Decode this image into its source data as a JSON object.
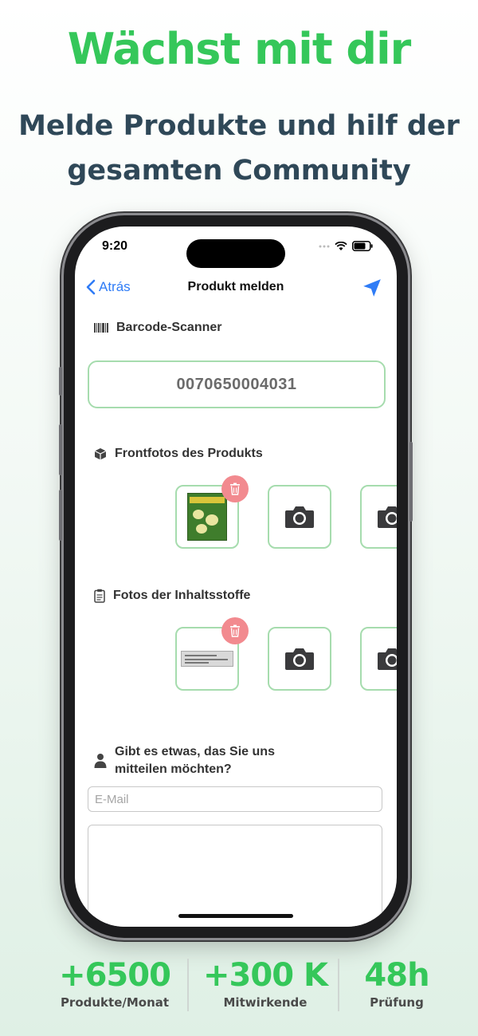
{
  "promo": {
    "headline": "Wächst mit dir",
    "subline_1": "Melde Produkte und hilf der",
    "subline_2": "gesamten Community"
  },
  "status_bar": {
    "time": "9:20"
  },
  "navbar": {
    "back_label": "Atrás",
    "title": "Produkt melden"
  },
  "barcode_section": {
    "heading": "Barcode-Scanner",
    "value": "0070650004031"
  },
  "front_photos": {
    "heading": "Frontfotos des Produkts",
    "slots": [
      "filled",
      "empty",
      "empty"
    ]
  },
  "ingredient_photos": {
    "heading": "Fotos der Inhaltsstoffe",
    "slots": [
      "filled",
      "empty",
      "empty"
    ]
  },
  "feedback": {
    "question_line_1": "Gibt es etwas, das Sie uns",
    "question_line_2": "mitteilen möchten?",
    "email_placeholder": "E-Mail",
    "email_value": "",
    "message_value": ""
  },
  "stats": [
    {
      "value": "+6500",
      "label": "Produkte/Monat"
    },
    {
      "value": "+300 K",
      "label": "Mitwirkende"
    },
    {
      "value": "48h",
      "label": "Prüfung"
    }
  ],
  "colors": {
    "accent_green": "#35c75a",
    "slot_border": "#a6dcae",
    "ios_blue": "#2f7cf6",
    "trash_bg": "#f28a8f",
    "heading_dark": "#2f4858"
  },
  "icons": {
    "barcode": "barcode-icon",
    "front": "box-icon",
    "ingredients": "clipboard-icon",
    "question": "person-icon",
    "camera": "camera-icon",
    "trash": "trash-icon",
    "send": "send-icon",
    "back": "chevron-left-icon"
  }
}
